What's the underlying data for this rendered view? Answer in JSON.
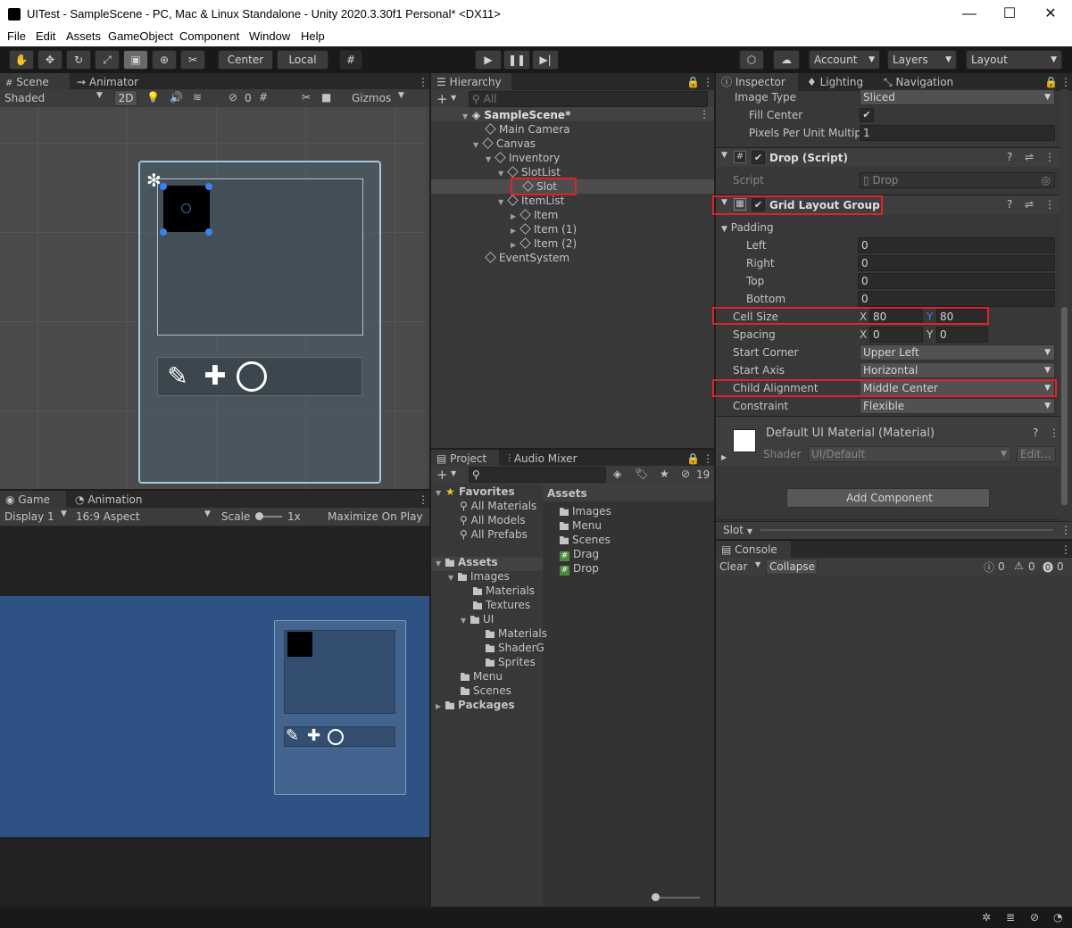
{
  "window": {
    "title": "UITest - SampleScene - PC, Mac & Linux Standalone - Unity 2020.3.30f1 Personal* <DX11>",
    "minimize": "—",
    "maximize": "☐",
    "close": "✕"
  },
  "menu": [
    "File",
    "Edit",
    "Assets",
    "GameObject",
    "Component",
    "Window",
    "Help"
  ],
  "toolbar": {
    "center": "Center",
    "local": "Local",
    "account": "Account",
    "layers": "Layers",
    "layout": "Layout"
  },
  "scene": {
    "tab_scene": "Scene",
    "tab_animator": "Animator",
    "shading": "Shaded",
    "mode_2d": "2D",
    "hidden_count": "0",
    "gizmos": "Gizmos"
  },
  "game": {
    "tab_game": "Game",
    "tab_animation": "Animation",
    "display": "Display 1",
    "aspect": "16:9 Aspect",
    "scale_label": "Scale",
    "scale_value": "1x",
    "maximize": "Maximize On Play"
  },
  "hierarchy": {
    "tab": "Hierarchy",
    "search_placeholder": "All",
    "items": [
      "SampleScene*",
      "Main Camera",
      "Canvas",
      "Inventory",
      "SlotList",
      "Slot",
      "ItemList",
      "Item",
      "Item (1)",
      "Item (2)",
      "EventSystem"
    ]
  },
  "project": {
    "tab_project": "Project",
    "tab_audio": "Audio Mixer",
    "hidden_count": "19",
    "favorites": "Favorites",
    "fav_items": [
      "All Materials",
      "All Models",
      "All Prefabs"
    ],
    "assets": "Assets",
    "tree": [
      "Images",
      "Materials",
      "Textures",
      "UI",
      "Materials",
      "ShaderG",
      "Sprites",
      "Menu",
      "Scenes"
    ],
    "packages": "Packages",
    "assets_header": "Assets",
    "files": [
      "Images",
      "Menu",
      "Scenes",
      "Drag",
      "Drop"
    ]
  },
  "inspector": {
    "tab_inspector": "Inspector",
    "tab_lighting": "Lighting",
    "tab_navigation": "Navigation",
    "image_type_label": "Image Type",
    "image_type_value": "Sliced",
    "fill_center_label": "Fill Center",
    "ppu_label": "Pixels Per Unit Multipli",
    "ppu_value": "1",
    "drop_script_title": "Drop (Script)",
    "script_label": "Script",
    "script_value": "Drop",
    "grid_title": "Grid Layout Group",
    "padding_label": "Padding",
    "padding": [
      {
        "label": "Left",
        "value": "0"
      },
      {
        "label": "Right",
        "value": "0"
      },
      {
        "label": "Top",
        "value": "0"
      },
      {
        "label": "Bottom",
        "value": "0"
      }
    ],
    "cell_size_label": "Cell Size",
    "cell_x": "80",
    "cell_y": "80",
    "spacing_label": "Spacing",
    "spacing_x": "0",
    "spacing_y": "0",
    "x": "X",
    "y": "Y",
    "start_corner_label": "Start Corner",
    "start_corner_value": "Upper Left",
    "start_axis_label": "Start Axis",
    "start_axis_value": "Horizontal",
    "child_align_label": "Child Alignment",
    "child_align_value": "Middle Center",
    "constraint_label": "Constraint",
    "constraint_value": "Flexible",
    "material_title": "Default UI Material (Material)",
    "shader_label": "Shader",
    "shader_value": "UI/Default",
    "edit": "Edit...",
    "add_component": "Add Component",
    "footer": "Slot"
  },
  "console": {
    "tab": "Console",
    "clear": "Clear",
    "collapse": "Collapse",
    "count_log": "0",
    "count_warn": "0",
    "count_err": "0"
  },
  "colors": {
    "highlight": "#e0222a",
    "game_bg": "#2e5283",
    "accent": "#4c7bd3"
  }
}
